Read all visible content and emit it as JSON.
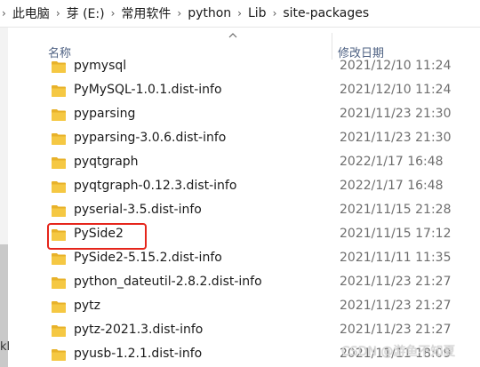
{
  "breadcrumb": [
    "此电脑",
    "芽 (E:)",
    "常用软件",
    "python",
    "Lib",
    "site-packages"
  ],
  "nav": {
    "partial_text": "kl"
  },
  "columns": {
    "name": "名称",
    "date_modified": "修改日期"
  },
  "rows": [
    {
      "name": "pymysql",
      "date": "2021/12/10 11:24"
    },
    {
      "name": "PyMySQL-1.0.1.dist-info",
      "date": "2021/12/10 11:24"
    },
    {
      "name": "pyparsing",
      "date": "2021/11/23 21:30"
    },
    {
      "name": "pyparsing-3.0.6.dist-info",
      "date": "2021/11/23 21:30"
    },
    {
      "name": "pyqtgraph",
      "date": "2022/1/17 16:48"
    },
    {
      "name": "pyqtgraph-0.12.3.dist-info",
      "date": "2022/1/17 16:48"
    },
    {
      "name": "pyserial-3.5.dist-info",
      "date": "2021/11/15 21:28"
    },
    {
      "name": "PySide2",
      "date": "2021/11/15 17:12"
    },
    {
      "name": "PySide2-5.15.2.dist-info",
      "date": "2021/11/11 11:35"
    },
    {
      "name": "python_dateutil-2.8.2.dist-info",
      "date": "2021/11/23 21:27"
    },
    {
      "name": "pytz",
      "date": "2021/11/23 21:27"
    },
    {
      "name": "pytz-2021.3.dist-info",
      "date": "2021/11/23 21:27"
    },
    {
      "name": "pyusb-1.2.1.dist-info",
      "date": "2021/11/11 18:09"
    }
  ],
  "highlighted_row": "PySide2",
  "watermark": "CSDN @游鱼不知夏",
  "colors": {
    "folder": "#f0c33c",
    "highlight": "#e5251b",
    "header_text": "#4d6082"
  }
}
